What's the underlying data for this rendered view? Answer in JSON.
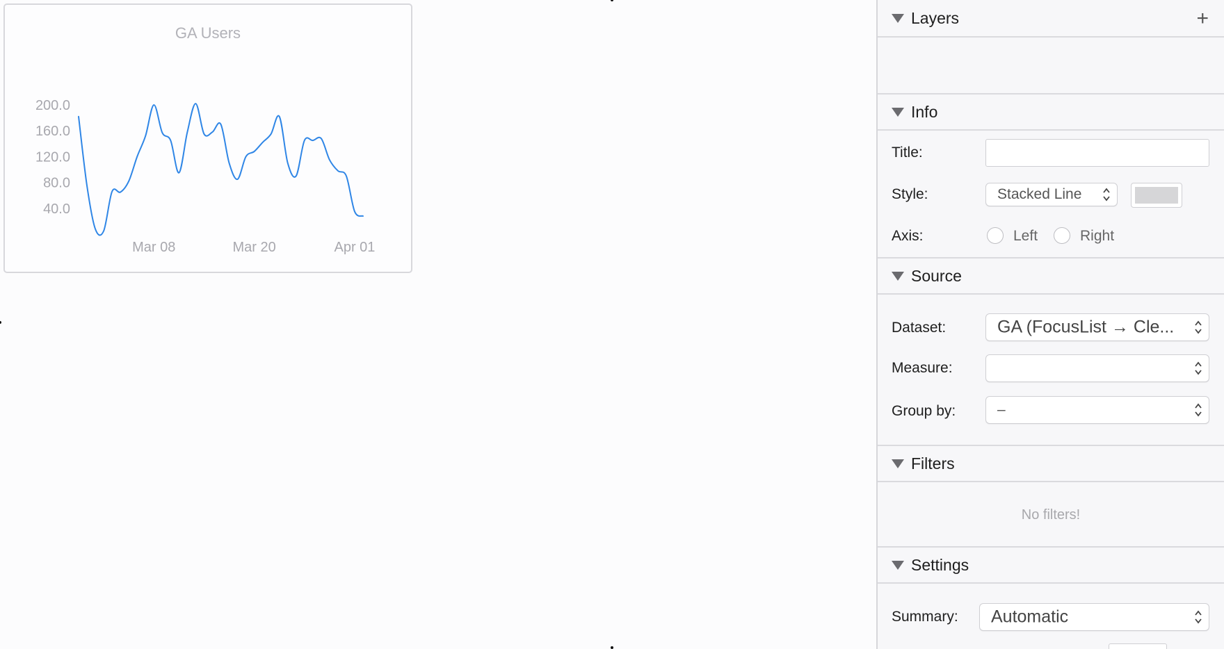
{
  "chart_data": {
    "type": "line",
    "title": "GA Users",
    "xlabel": "",
    "ylabel": "",
    "y_ticks": [
      "200.0",
      "160.0",
      "120.0",
      "80.0",
      "40.0"
    ],
    "y_tick_values": [
      200,
      160,
      120,
      80,
      40
    ],
    "x_ticks": [
      "Mar 08",
      "Mar 20",
      "Apr 01"
    ],
    "ylim": [
      0,
      215
    ],
    "grid": false,
    "line_color": "#2f86e6",
    "x": [
      "Feb 27",
      "Feb 28",
      "Mar 01",
      "Mar 02",
      "Mar 03",
      "Mar 04",
      "Mar 05",
      "Mar 06",
      "Mar 07",
      "Mar 08",
      "Mar 09",
      "Mar 10",
      "Mar 11",
      "Mar 12",
      "Mar 13",
      "Mar 14",
      "Mar 15",
      "Mar 16",
      "Mar 17",
      "Mar 18",
      "Mar 19",
      "Mar 20",
      "Mar 21",
      "Mar 22",
      "Mar 23",
      "Mar 24",
      "Mar 25",
      "Mar 26",
      "Mar 27",
      "Mar 28",
      "Mar 29",
      "Mar 30",
      "Mar 31",
      "Apr 01",
      "Apr 02"
    ],
    "values": [
      182,
      75,
      8,
      5,
      66,
      65,
      82,
      120,
      152,
      200,
      157,
      145,
      95,
      158,
      202,
      155,
      158,
      170,
      110,
      85,
      120,
      128,
      142,
      155,
      182,
      110,
      90,
      145,
      145,
      148,
      115,
      98,
      90,
      35,
      28
    ]
  },
  "canvas": {
    "handle_color": "#111111"
  },
  "inspector": {
    "layers": {
      "title": "Layers",
      "add_icon": "plus-icon"
    },
    "info": {
      "title": "Info",
      "title_label": "Title:",
      "title_value": "",
      "style_label": "Style:",
      "style_value": "Stacked Line",
      "color_well": "#d6d6d8",
      "axis_label": "Axis:",
      "axis_left": "Left",
      "axis_right": "Right"
    },
    "source": {
      "title": "Source",
      "dataset_label": "Dataset:",
      "dataset_value": "GA (FocusList → Cle...",
      "measure_label": "Measure:",
      "measure_value": "",
      "groupby_label": "Group by:",
      "groupby_value": "–"
    },
    "filters": {
      "title": "Filters",
      "empty_text": "No filters!"
    },
    "settings": {
      "title": "Settings",
      "summary_label": "Summary:",
      "summary_value": "Automatic"
    }
  }
}
